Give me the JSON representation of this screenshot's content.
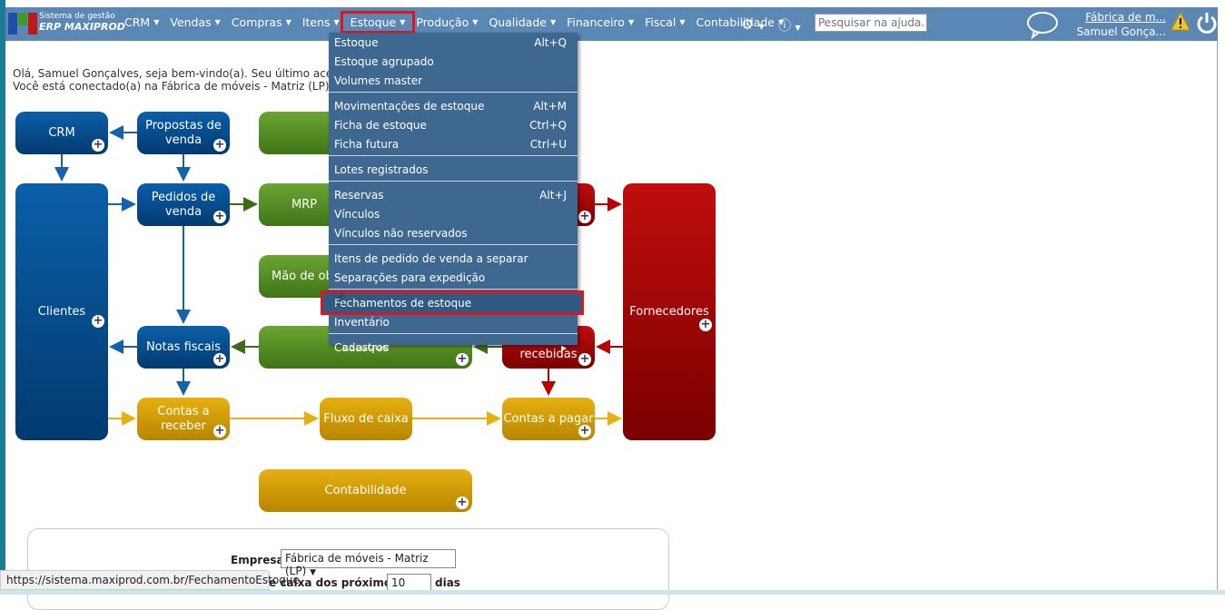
{
  "header": {
    "brand_small": "Sistema de gestão",
    "brand_big": "ERP MAXIPROD",
    "nav": [
      "CRM",
      "Vendas",
      "Compras",
      "Itens",
      "Estoque",
      "Produção",
      "Qualidade",
      "Financeiro",
      "Fiscal",
      "Contabilidade"
    ],
    "active_nav": "Estoque",
    "search_placeholder": "Pesquisar na ajuda...",
    "company_link": "Fábrica de m...",
    "user_name": "Samuel Gonça..."
  },
  "greeting": {
    "line1": "Olá, Samuel Gonçalves, seja bem-vindo(a). Seu último acesso fo",
    "line2": "Você está conectado(a) na Fábrica de móveis - Matriz (LP)."
  },
  "menu": {
    "groups": [
      [
        {
          "label": "Estoque",
          "shortcut": "Alt+Q"
        },
        {
          "label": "Estoque agrupado",
          "shortcut": ""
        },
        {
          "label": "Volumes master",
          "shortcut": ""
        }
      ],
      [
        {
          "label": "Movimentações de estoque",
          "shortcut": "Alt+M"
        },
        {
          "label": "Ficha de estoque",
          "shortcut": "Ctrl+Q"
        },
        {
          "label": "Ficha futura",
          "shortcut": "Ctrl+U"
        }
      ],
      [
        {
          "label": "Lotes registrados",
          "shortcut": ""
        }
      ],
      [
        {
          "label": "Reservas",
          "shortcut": "Alt+J"
        },
        {
          "label": "Vínculos",
          "shortcut": ""
        },
        {
          "label": "Vínculos não reservados",
          "shortcut": ""
        }
      ],
      [
        {
          "label": "Itens de pedido de venda a separar",
          "shortcut": ""
        },
        {
          "label": "Separações para expedição",
          "shortcut": ""
        }
      ],
      [
        {
          "label": "Fechamentos de estoque",
          "shortcut": ""
        },
        {
          "label": "Inventário",
          "shortcut": ""
        }
      ],
      [
        {
          "label": "Cadastros",
          "shortcut": "▸"
        }
      ]
    ],
    "highlighted": "Fechamentos de estoque"
  },
  "diagram": {
    "crm": "CRM",
    "propostas": "Propostas de venda",
    "clientes": "Clientes",
    "pedidos": "Pedidos de venda",
    "mrp": "MRP",
    "mao": "Mão de obra",
    "notas": "Notas fiscais",
    "estoque": "Estoque",
    "notas_rec": "Notas recebidas",
    "fornecedores": "Fornecedores",
    "receber": "Contas a receber",
    "fluxo": "Fluxo de caixa",
    "pagar": "Contas a pagar",
    "contabilidade": "Contabilidade"
  },
  "form": {
    "empresa_label": "Empresa",
    "empresa_value": "Fábrica de móveis - Matriz (LP)",
    "caixa_label": "e caixa dos próximos",
    "dias_value": "10",
    "dias_label": "dias"
  },
  "status_url": "https://sistema.maxiprod.com.br/FechamentoEstoque",
  "colors": {
    "header": "#5b87b5",
    "menu": "#3e6890",
    "highlight": "#e0141e"
  }
}
